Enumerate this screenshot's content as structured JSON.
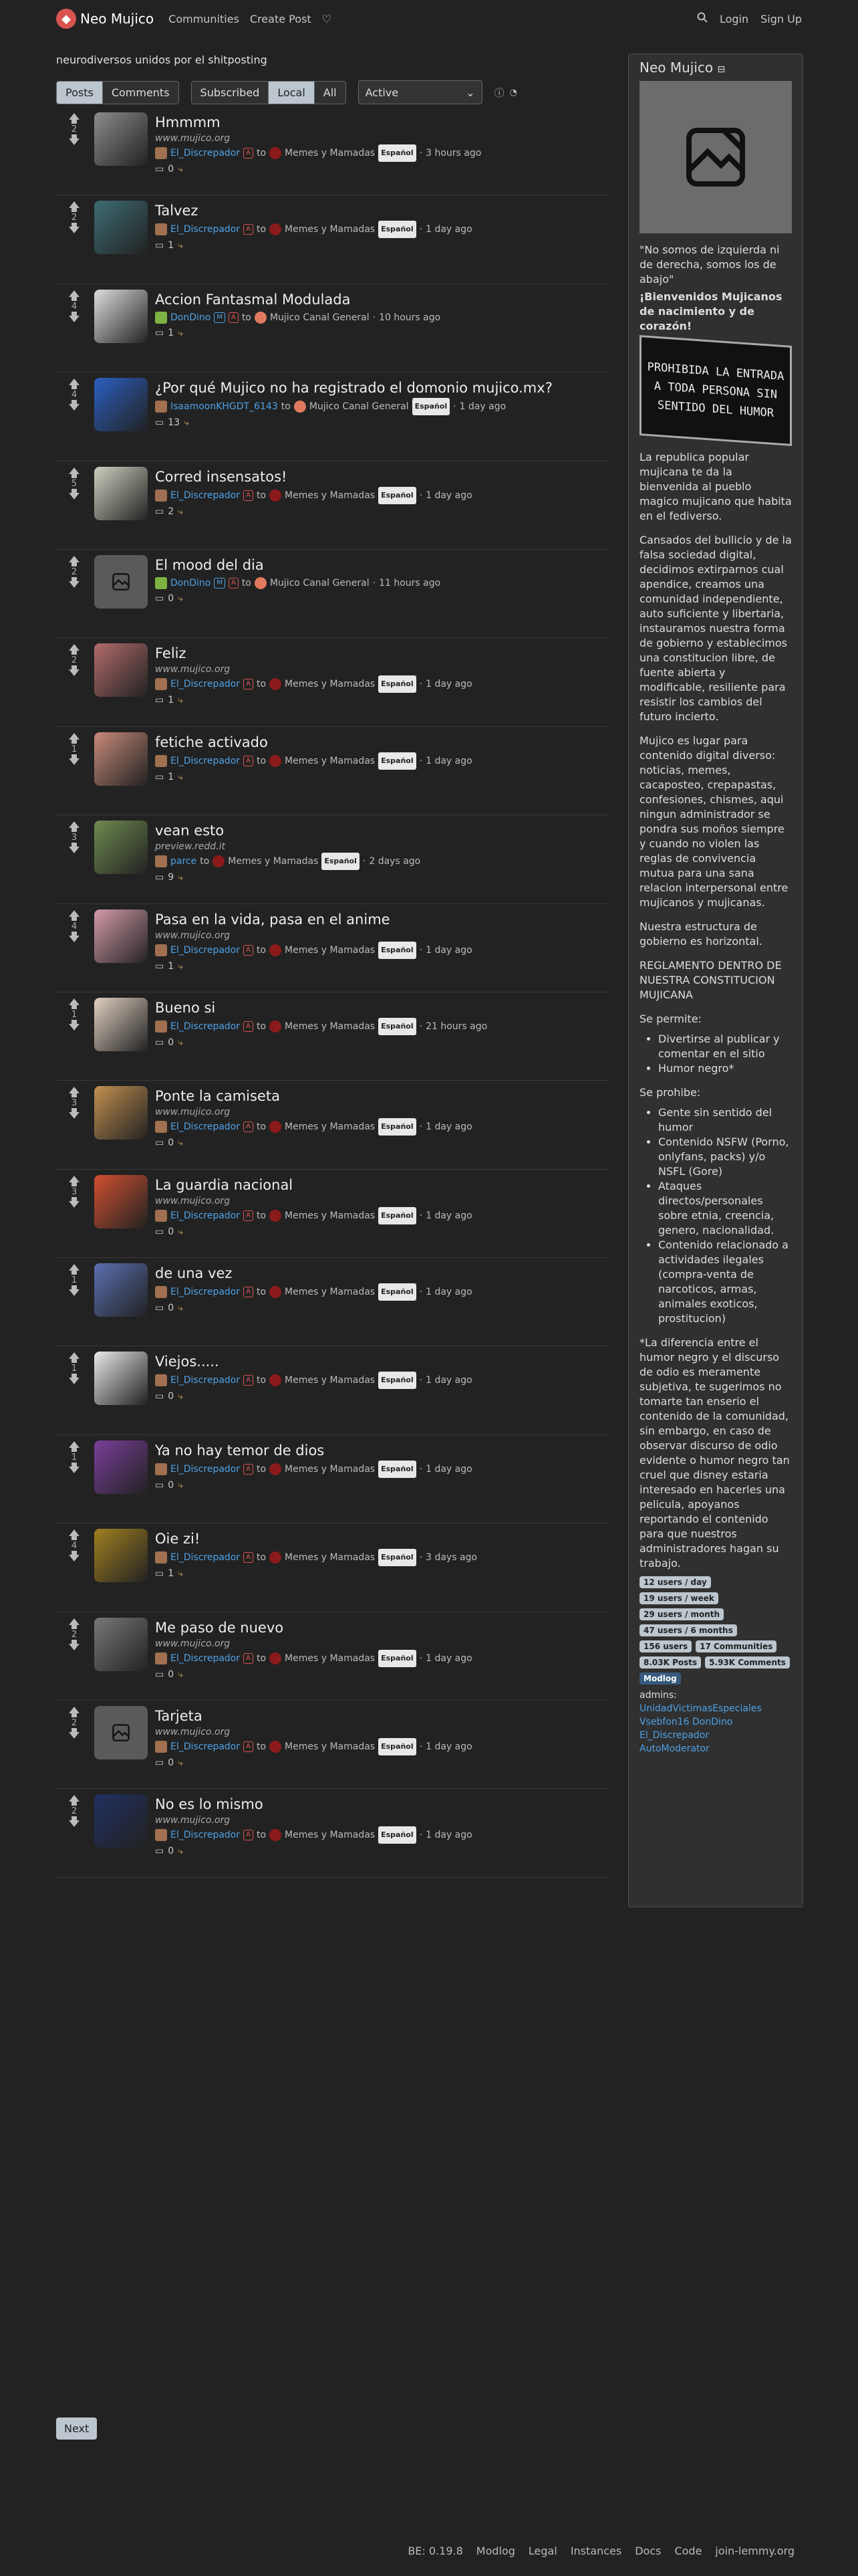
{
  "nav": {
    "brand": "Neo Mujico",
    "communities": "Communities",
    "create_post": "Create Post",
    "login": "Login",
    "signup": "Sign Up"
  },
  "tagline": "neurodiversos unidos por el shitposting",
  "tabs": {
    "posts": "Posts",
    "comments": "Comments",
    "subscribed": "Subscribed",
    "local": "Local",
    "all": "All",
    "sort": "Active"
  },
  "posts": [
    {
      "votes": "2",
      "title": "Hmmmm",
      "domain": "www.mujico.org",
      "user": "El_Discrepador",
      "community": "Memes y Mamadas",
      "lang": "Español",
      "time": "3 hours ago",
      "comments": "0"
    },
    {
      "votes": "2",
      "title": "Talvez",
      "domain": "",
      "user": "El_Discrepador",
      "community": "Memes y Mamadas",
      "lang": "Español",
      "time": "1 day ago",
      "comments": "1"
    },
    {
      "votes": "4",
      "title": "Accion Fantasmal Modulada",
      "domain": "",
      "user": "DonDino",
      "community": "Mujico Canal General",
      "lang": "",
      "time": "10 hours ago",
      "comments": "1"
    },
    {
      "votes": "4",
      "title": "¿Por qué Mujico no ha registrado el domonio mujico.mx?",
      "domain": "",
      "user": "IsaamoonKHGDT_6143",
      "community": "Mujico Canal General",
      "lang": "Español",
      "time": "1 day ago",
      "comments": "13"
    },
    {
      "votes": "5",
      "title": "Corred insensatos!",
      "domain": "",
      "user": "El_Discrepador",
      "community": "Memes y Mamadas",
      "lang": "Español",
      "time": "1 day ago",
      "comments": "2"
    },
    {
      "votes": "2",
      "title": "El mood del dia",
      "domain": "",
      "user": "DonDino",
      "community": "Mujico Canal General",
      "lang": "",
      "time": "11 hours ago",
      "comments": "0"
    },
    {
      "votes": "2",
      "title": "Feliz",
      "domain": "www.mujico.org",
      "user": "El_Discrepador",
      "community": "Memes y Mamadas",
      "lang": "Español",
      "time": "1 day ago",
      "comments": "1"
    },
    {
      "votes": "1",
      "title": "fetiche activado",
      "domain": "",
      "user": "El_Discrepador",
      "community": "Memes y Mamadas",
      "lang": "Español",
      "time": "1 day ago",
      "comments": "1"
    },
    {
      "votes": "3",
      "title": "vean esto",
      "domain": "preview.redd.it",
      "user": "parce",
      "community": "Memes y Mamadas",
      "lang": "Español",
      "time": "2 days ago",
      "comments": "9"
    },
    {
      "votes": "4",
      "title": "Pasa en la vida, pasa en el anime",
      "domain": "www.mujico.org",
      "user": "El_Discrepador",
      "community": "Memes y Mamadas",
      "lang": "Español",
      "time": "1 day ago",
      "comments": "1"
    },
    {
      "votes": "1",
      "title": "Bueno si",
      "domain": "",
      "user": "El_Discrepador",
      "community": "Memes y Mamadas",
      "lang": "Español",
      "time": "21 hours ago",
      "comments": "0"
    },
    {
      "votes": "3",
      "title": "Ponte la camiseta",
      "domain": "www.mujico.org",
      "user": "El_Discrepador",
      "community": "Memes y Mamadas",
      "lang": "Español",
      "time": "1 day ago",
      "comments": "0"
    },
    {
      "votes": "3",
      "title": "La guardia nacional",
      "domain": "www.mujico.org",
      "user": "El_Discrepador",
      "community": "Memes y Mamadas",
      "lang": "Español",
      "time": "1 day ago",
      "comments": "0"
    },
    {
      "votes": "1",
      "title": "de una vez",
      "domain": "",
      "user": "El_Discrepador",
      "community": "Memes y Mamadas",
      "lang": "Español",
      "time": "1 day ago",
      "comments": "0"
    },
    {
      "votes": "1",
      "title": "Viejos.....",
      "domain": "",
      "user": "El_Discrepador",
      "community": "Memes y Mamadas",
      "lang": "Español",
      "time": "1 day ago",
      "comments": "0"
    },
    {
      "votes": "1",
      "title": "Ya no hay temor de dios",
      "domain": "",
      "user": "El_Discrepador",
      "community": "Memes y Mamadas",
      "lang": "Español",
      "time": "1 day ago",
      "comments": "0"
    },
    {
      "votes": "4",
      "title": "Oie zi!",
      "domain": "",
      "user": "El_Discrepador",
      "community": "Memes y Mamadas",
      "lang": "Español",
      "time": "3 days ago",
      "comments": "1"
    },
    {
      "votes": "2",
      "title": "Me paso de nuevo",
      "domain": "www.mujico.org",
      "user": "El_Discrepador",
      "community": "Memes y Mamadas",
      "lang": "Español",
      "time": "1 day ago",
      "comments": "0"
    },
    {
      "votes": "2",
      "title": "Tarjeta",
      "domain": "www.mujico.org",
      "user": "El_Discrepador",
      "community": "Memes y Mamadas",
      "lang": "Español",
      "time": "1 day ago",
      "comments": "0"
    },
    {
      "votes": "2",
      "title": "No es lo mismo",
      "domain": "www.mujico.org",
      "user": "El_Discrepador",
      "community": "Memes y Mamadas",
      "lang": "Español",
      "time": "1 day ago",
      "comments": "0"
    }
  ],
  "next": "Next",
  "sidebar": {
    "title": "Neo Mujico",
    "quote": "\"No somos de izquierda ni de derecha, somos los de abajo\"",
    "welcome": "¡Bienvenidos Mujicanos de nacimiento y de corazón!",
    "sign_text": "PROHIBIDA LA ENTRADA A TODA PERSONA SIN SENTIDO DEL HUMOR",
    "p1": "La republica popular mujicana te da la bienvenida al pueblo magico mujicano que habita en el fediverso.",
    "p2": "Cansados del bullicio y de la falsa sociedad digital, decidimos extirparnos cual apendice, creamos una comunidad independiente, auto suficiente y libertaria, instauramos nuestra forma de gobierno y establecimos una constitucion libre, de fuente abierta y modificable, resiliente para resistir los cambios del futuro incierto.",
    "p3": "Mujico es lugar para contenido digital diverso: noticias, memes, cacaposteo, crepapastas, confesiones, chismes, aqui ningun administrador se pondra sus moños siempre y cuando no violen las reglas de convivencia mutua para una sana relacion interpersonal entre mujicanos y mujicanas.",
    "p4": "Nuestra estructura de gobierno es horizontal.",
    "p5": "REGLAMENTO DENTRO DE NUESTRA CONSTITUCION MUJICANA",
    "permite": "Se permite:",
    "permite_items": [
      "Divertirse al publicar y comentar en el sitio",
      "Humor negro*"
    ],
    "prohibe": "Se prohibe:",
    "prohibe_items": [
      "Gente sin sentido del humor",
      "Contenido NSFW (Porno, onlyfans, packs) y/o NSFL (Gore)",
      "Ataques directos/personales sobre etnia, creencia, genero, nacionalidad.",
      "Contenido relacionado a actividades ilegales (compra-venta de narcoticos, armas, animales exoticos, prostitucion)"
    ],
    "p6": "*La diferencia entre el humor negro y el discurso de odio es meramente subjetiva, te sugerimos no tomarte tan enserio el contenido de la comunidad, sin embargo, en caso de observar discurso de odio evidente o humor negro tan cruel que disney estaria interesado en hacerles una pelicula, apoyanos reportando el contenido para que nuestros administradores hagan su trabajo.",
    "stats": [
      "12 users / day",
      "19 users / week",
      "29 users / month",
      "47 users / 6 months",
      "156 users",
      "17 Communities",
      "8.03K Posts",
      "5.93K Comments"
    ],
    "modlog": "Modlog",
    "admins_label": "admins:",
    "admins": [
      "UnidadVictimasEspeciales",
      "Vsebfon16",
      "DonDino",
      "El_Discrepador",
      "AutoModerator"
    ]
  },
  "footer": {
    "version": "BE: 0.19.8",
    "modlog": "Modlog",
    "legal": "Legal",
    "instances": "Instances",
    "docs": "Docs",
    "code": "Code",
    "site": "join-lemmy.org"
  }
}
